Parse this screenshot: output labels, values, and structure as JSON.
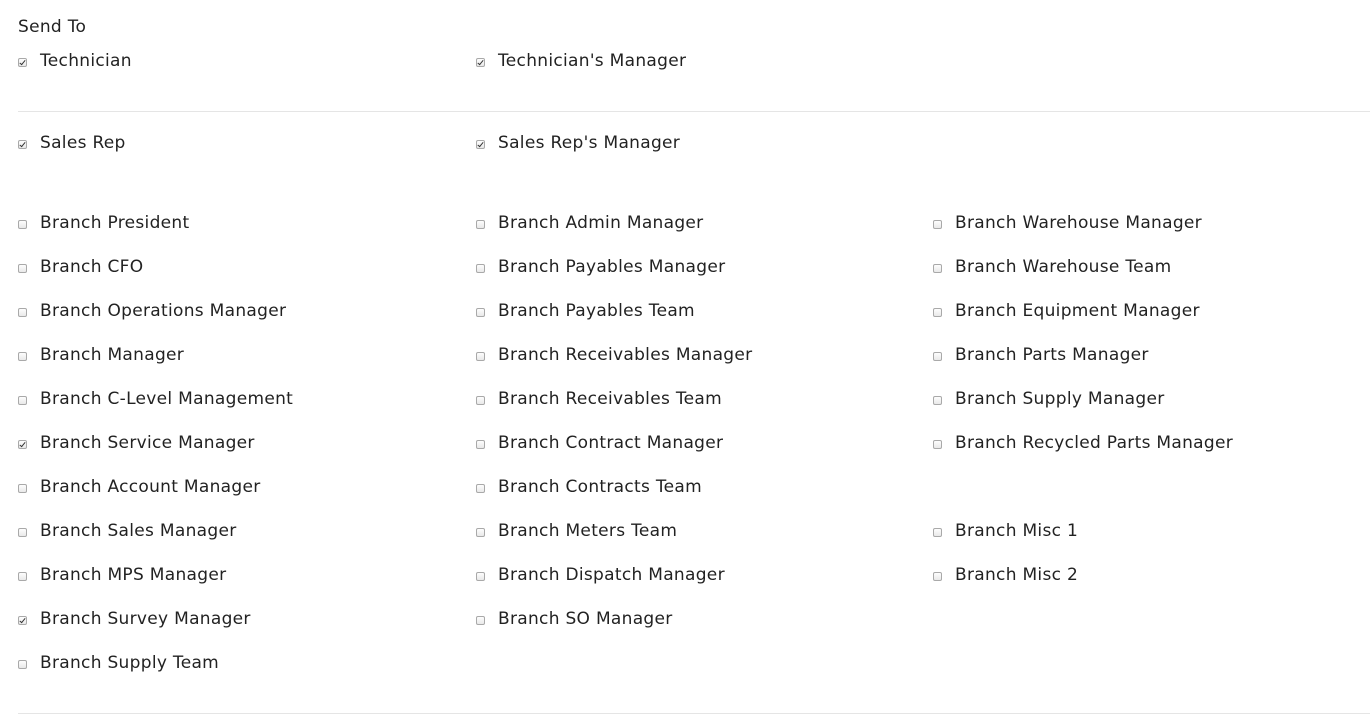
{
  "section": {
    "title": "Send To"
  },
  "rows": [
    {
      "items": [
        {
          "label": "Technician",
          "checked": true
        },
        {
          "label": "Technician's Manager",
          "checked": true
        },
        null
      ]
    },
    {
      "items": [
        {
          "label": "Sales Rep",
          "checked": true
        },
        {
          "label": "Sales Rep's Manager",
          "checked": true
        },
        null
      ]
    },
    {
      "items": [
        {
          "label": "Branch President",
          "checked": false
        },
        {
          "label": "Branch Admin Manager",
          "checked": false
        },
        {
          "label": "Branch Warehouse Manager",
          "checked": false
        }
      ]
    },
    {
      "items": [
        {
          "label": "Branch CFO",
          "checked": false
        },
        {
          "label": "Branch Payables Manager",
          "checked": false
        },
        {
          "label": "Branch Warehouse Team",
          "checked": false
        }
      ]
    },
    {
      "items": [
        {
          "label": "Branch Operations Manager",
          "checked": false
        },
        {
          "label": "Branch Payables Team",
          "checked": false
        },
        {
          "label": "Branch Equipment Manager",
          "checked": false
        }
      ]
    },
    {
      "items": [
        {
          "label": "Branch Manager",
          "checked": false
        },
        {
          "label": "Branch Receivables Manager",
          "checked": false
        },
        {
          "label": "Branch Parts Manager",
          "checked": false
        }
      ]
    },
    {
      "items": [
        {
          "label": "Branch C-Level Management",
          "checked": false
        },
        {
          "label": "Branch Receivables Team",
          "checked": false
        },
        {
          "label": "Branch Supply Manager",
          "checked": false
        }
      ]
    },
    {
      "items": [
        {
          "label": "Branch Service Manager",
          "checked": true
        },
        {
          "label": "Branch Contract Manager",
          "checked": false
        },
        {
          "label": "Branch Recycled Parts Manager",
          "checked": false
        }
      ]
    },
    {
      "items": [
        {
          "label": "Branch Account Manager",
          "checked": false
        },
        {
          "label": "Branch Contracts Team",
          "checked": false
        },
        null
      ]
    },
    {
      "items": [
        {
          "label": "Branch Sales Manager",
          "checked": false
        },
        {
          "label": "Branch Meters Team",
          "checked": false
        },
        {
          "label": "Branch Misc 1",
          "checked": false
        }
      ]
    },
    {
      "items": [
        {
          "label": "Branch MPS Manager",
          "checked": false
        },
        {
          "label": "Branch Dispatch Manager",
          "checked": false
        },
        {
          "label": "Branch Misc 2",
          "checked": false
        }
      ]
    },
    {
      "items": [
        {
          "label": "Branch Survey Manager",
          "checked": true
        },
        {
          "label": "Branch SO Manager",
          "checked": false
        },
        null
      ]
    },
    {
      "items": [
        {
          "label": "Branch Supply Team",
          "checked": false
        },
        null,
        null
      ]
    }
  ]
}
